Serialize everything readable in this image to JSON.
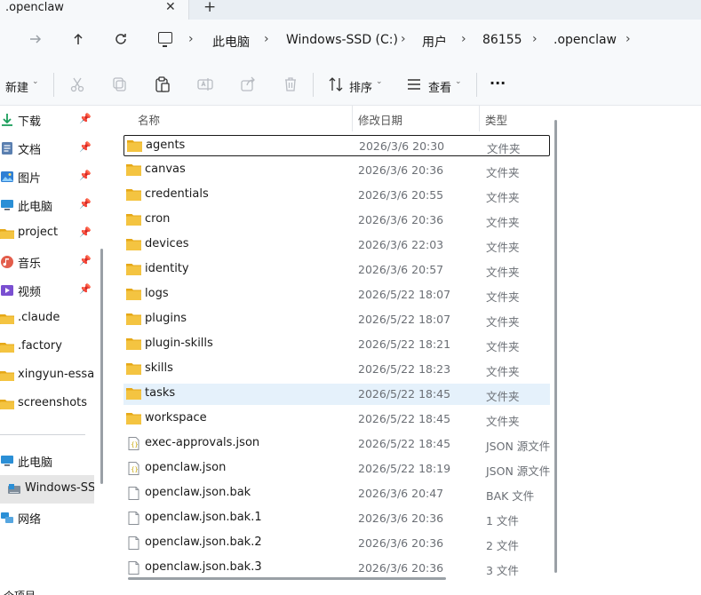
{
  "tab": {
    "title": ".openclaw",
    "close_glyph": "✕",
    "new_glyph": "+"
  },
  "nav": {
    "forward_icon": "arrow-right-icon",
    "up_icon": "arrow-up-icon",
    "refresh_icon": "refresh-icon"
  },
  "breadcrumb": [
    "此电脑",
    "Windows-SSD (C:)",
    "用户",
    "86155",
    ".openclaw"
  ],
  "toolbar": {
    "new_label": "新建",
    "sort_label": "排序",
    "view_label": "查看",
    "more_label": "···"
  },
  "sidebar": {
    "items": [
      {
        "label": "下载",
        "icon": "download-icon",
        "pinned": true
      },
      {
        "label": "文档",
        "icon": "documents-icon",
        "pinned": true
      },
      {
        "label": "图片",
        "icon": "pictures-icon",
        "pinned": true
      },
      {
        "label": "此电脑",
        "icon": "computer-icon",
        "pinned": true
      },
      {
        "label": "project",
        "icon": "folder-icon",
        "pinned": true
      },
      {
        "label": "音乐",
        "icon": "music-icon",
        "pinned": true
      },
      {
        "label": "视频",
        "icon": "video-icon",
        "pinned": true
      },
      {
        "label": ".claude",
        "icon": "folder-icon",
        "pinned": false
      },
      {
        "label": ".factory",
        "icon": "folder-icon",
        "pinned": false
      },
      {
        "label": "xingyun-essay",
        "icon": "folder-icon",
        "pinned": false
      },
      {
        "label": "screenshots",
        "icon": "folder-icon",
        "pinned": false
      }
    ],
    "tree": [
      {
        "label": "此电脑",
        "icon": "computer-icon"
      },
      {
        "label": "Windows-SSD",
        "icon": "drive-icon"
      },
      {
        "label": "网络",
        "icon": "network-icon"
      }
    ]
  },
  "columns": {
    "name": "名称",
    "date": "修改日期",
    "type": "类型"
  },
  "files": [
    {
      "name": "agents",
      "date": "2026/3/6 20:30",
      "type": "文件夹",
      "kind": "folder"
    },
    {
      "name": "canvas",
      "date": "2026/3/6 20:36",
      "type": "文件夹",
      "kind": "folder"
    },
    {
      "name": "credentials",
      "date": "2026/3/6 20:55",
      "type": "文件夹",
      "kind": "folder"
    },
    {
      "name": "cron",
      "date": "2026/3/6 20:36",
      "type": "文件夹",
      "kind": "folder"
    },
    {
      "name": "devices",
      "date": "2026/3/6 22:03",
      "type": "文件夹",
      "kind": "folder"
    },
    {
      "name": "identity",
      "date": "2026/3/6 20:57",
      "type": "文件夹",
      "kind": "folder"
    },
    {
      "name": "logs",
      "date": "2026/5/22 18:07",
      "type": "文件夹",
      "kind": "folder"
    },
    {
      "name": "plugins",
      "date": "2026/5/22 18:07",
      "type": "文件夹",
      "kind": "folder"
    },
    {
      "name": "plugin-skills",
      "date": "2026/5/22 18:21",
      "type": "文件夹",
      "kind": "folder"
    },
    {
      "name": "skills",
      "date": "2026/5/22 18:23",
      "type": "文件夹",
      "kind": "folder"
    },
    {
      "name": "tasks",
      "date": "2026/5/22 18:45",
      "type": "文件夹",
      "kind": "folder"
    },
    {
      "name": "workspace",
      "date": "2026/5/22 18:45",
      "type": "文件夹",
      "kind": "folder"
    },
    {
      "name": "exec-approvals.json",
      "date": "2026/5/22 18:45",
      "type": "JSON 源文件",
      "kind": "json"
    },
    {
      "name": "openclaw.json",
      "date": "2026/5/22 18:19",
      "type": "JSON 源文件",
      "kind": "json"
    },
    {
      "name": "openclaw.json.bak",
      "date": "2026/3/6 20:47",
      "type": "BAK 文件",
      "kind": "file"
    },
    {
      "name": "openclaw.json.bak.1",
      "date": "2026/3/6 20:36",
      "type": "1 文件",
      "kind": "file"
    },
    {
      "name": "openclaw.json.bak.2",
      "date": "2026/3/6 20:36",
      "type": "2 文件",
      "kind": "file"
    },
    {
      "name": "openclaw.json.bak.3",
      "date": "2026/3/6 20:36",
      "type": "3 文件",
      "kind": "file"
    }
  ],
  "state": {
    "focused_row": "agents",
    "hovered_row": "tasks"
  },
  "status": {
    "text": "个项目"
  },
  "colors": {
    "folder": "#f4c441",
    "folder_dark": "#e6a817",
    "hover": "#e5f1fb",
    "selected": "#e6e6e6"
  }
}
